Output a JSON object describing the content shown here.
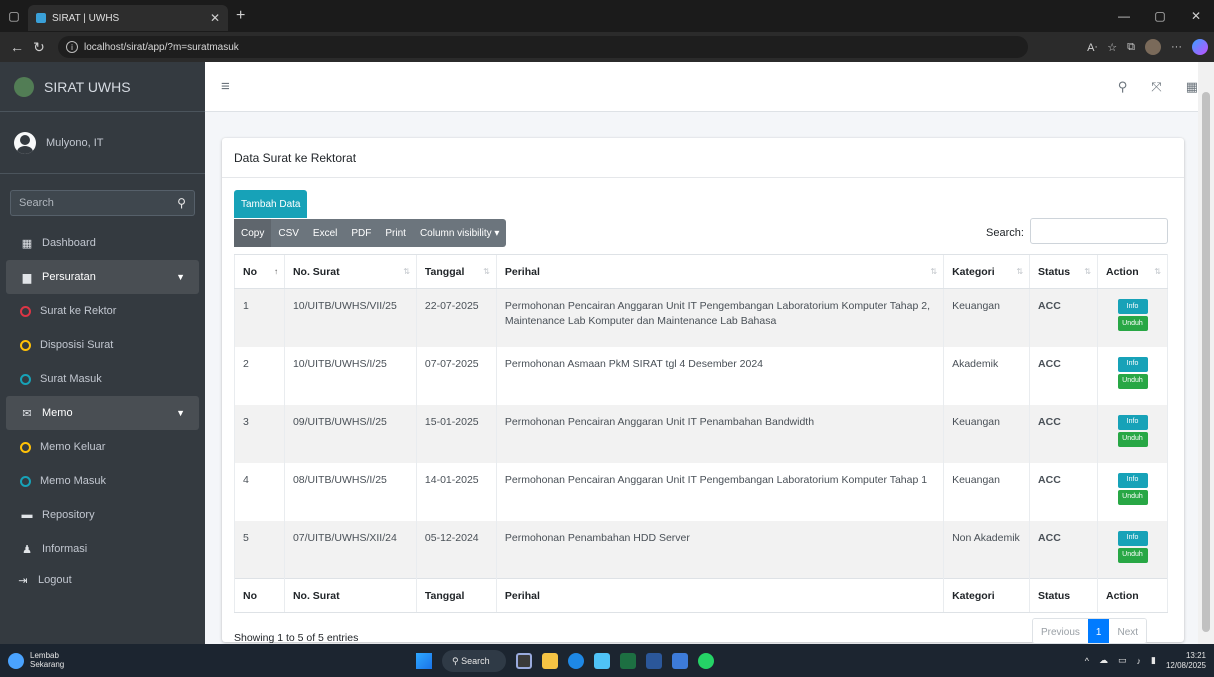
{
  "browser": {
    "tab_title": "SIRAT | UWHS",
    "url": "localhost/sirat/app/?m=suratmasuk"
  },
  "sidebar": {
    "brand": "SIRAT UWHS",
    "user": "Mulyono, IT",
    "search_placeholder": "Search",
    "items": [
      {
        "label": "Dashboard"
      },
      {
        "label": "Persuratan"
      },
      {
        "label": "Surat ke Rektor"
      },
      {
        "label": "Disposisi Surat"
      },
      {
        "label": "Surat Masuk"
      },
      {
        "label": "Memo"
      },
      {
        "label": "Memo Keluar"
      },
      {
        "label": "Memo Masuk"
      },
      {
        "label": "Repository"
      },
      {
        "label": "Informasi"
      },
      {
        "label": "Logout"
      }
    ]
  },
  "card": {
    "title": "Data Surat ke Rektorat",
    "add_button": "Tambah Data",
    "export_buttons": [
      "Copy",
      "CSV",
      "Excel",
      "PDF",
      "Print",
      "Column visibility ▾"
    ],
    "search_label": "Search:"
  },
  "table": {
    "headers": [
      "No",
      "No. Surat",
      "Tanggal",
      "Perihal",
      "Kategori",
      "Status",
      "Action"
    ],
    "rows": [
      {
        "no": "1",
        "no_surat": "10/UITB/UWHS/VII/25",
        "tanggal": "22-07-2025",
        "perihal": "Permohonan Pencairan Anggaran Unit IT Pengembangan Laboratorium Komputer Tahap 2, Maintenance Lab Komputer dan Maintenance Lab Bahasa",
        "kategori": "Keuangan",
        "status": "ACC"
      },
      {
        "no": "2",
        "no_surat": "10/UITB/UWHS/I/25",
        "tanggal": "07-07-2025",
        "perihal": "Permohonan Asmaan PkM SIRAT tgl 4 Desember 2024",
        "kategori": "Akademik",
        "status": "ACC"
      },
      {
        "no": "3",
        "no_surat": "09/UITB/UWHS/I/25",
        "tanggal": "15-01-2025",
        "perihal": "Permohonan Pencairan Anggaran Unit IT Penambahan Bandwidth",
        "kategori": "Keuangan",
        "status": "ACC"
      },
      {
        "no": "4",
        "no_surat": "08/UITB/UWHS/I/25",
        "tanggal": "14-01-2025",
        "perihal": "Permohonan Pencairan Anggaran Unit IT Pengembangan Laboratorium Komputer Tahap 1",
        "kategori": "Keuangan",
        "status": "ACC"
      },
      {
        "no": "5",
        "no_surat": "07/UITB/UWHS/XII/24",
        "tanggal": "05-12-2024",
        "perihal": "Permohonan Penambahan HDD Server",
        "kategori": "Non Akademik",
        "status": "ACC"
      }
    ],
    "action_info": "Info",
    "action_download": "Unduh"
  },
  "footer": {
    "info": "Showing 1 to 5 of 5 entries",
    "prev": "Previous",
    "page": "1",
    "next": "Next"
  },
  "taskbar": {
    "weather_title": "Lembab",
    "weather_sub": "Sekarang",
    "search": "Search",
    "time": "13:21",
    "date": "12/08/2025"
  },
  "colors": {
    "sidebar": "#343a40",
    "accent_info": "#17a2b8",
    "status_acc": "#28a745",
    "page_active": "#007bff"
  }
}
